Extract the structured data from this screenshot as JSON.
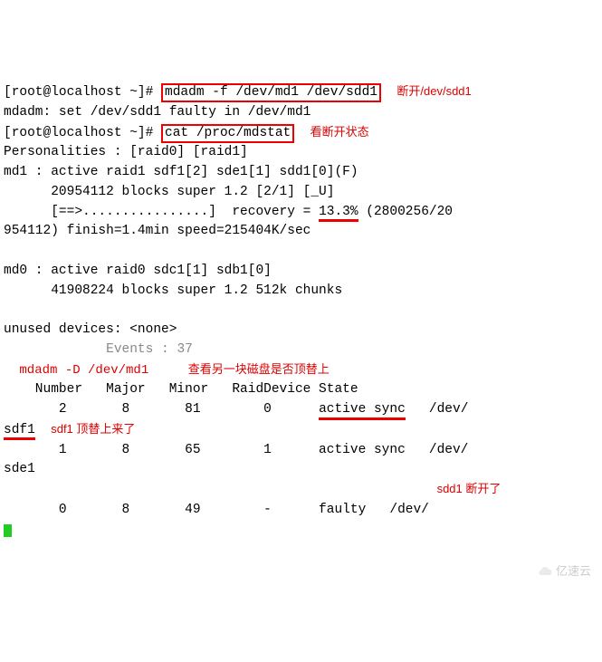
{
  "line1": {
    "prompt": "[root@localhost ~]#",
    "cmd": "mdadm -f /dev/md1 /dev/sdd1",
    "ann": "断开/dev/sdd1"
  },
  "line2": "mdadm: set /dev/sdd1 faulty in /dev/md1",
  "line3": {
    "prompt": "[root@localhost ~]#",
    "cmd": "cat /proc/mdstat",
    "ann": "看断开状态"
  },
  "line4": "Personalities : [raid0] [raid1]",
  "line5": "md1 : active raid1 sdf1[2] sde1[1] sdd1[0](F)",
  "line6": "      20954112 blocks super 1.2 [2/1] [_U]",
  "line7a": "      [==>................]  recovery = ",
  "line7b": "13.3%",
  "line7c": " (2800256/20",
  "line8": "954112) finish=1.4min speed=215404K/sec",
  "line10": "md0 : active raid0 sdc1[1] sdb1[0]",
  "line11": "      41908224 blocks super 1.2 512k chunks",
  "line13": "unused devices: <none>",
  "events": "Events : 37",
  "ann_cmd": "mdadm -D /dev/md1",
  "ann_check": "查看另一块磁盘是否顶替上",
  "hdr": "    Number   Major   Minor   RaidDevice State",
  "row1a": "       2       8       81        0      ",
  "row1b": "active sync",
  "row1c": "   /dev/",
  "row2dev": "sdf1",
  "ann_sdf1": "sdf1 顶替上来了",
  "row3": "       1       8       65        1      active sync   /dev/",
  "row4dev": "sde1",
  "ann_sdd1": "sdd1 断开了",
  "row5": "       0       8       49        -      faulty   /dev/",
  "watermark": "亿速云"
}
